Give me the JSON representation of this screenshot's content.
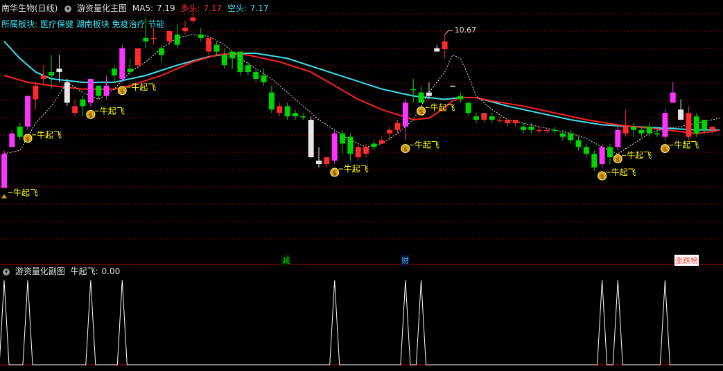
{
  "header": {
    "stock": "南华生物(日线)",
    "indicator": "游资量化主图",
    "ma5_label": "MA5:",
    "ma5_value": "7.19",
    "bull_label": "多头:",
    "bull_value": "7.17",
    "bear_label": "空头:",
    "bear_value": "7.17",
    "sector": "所属板块: 医疗保健 湖南板块 免疫治疗 节能"
  },
  "subheader": {
    "indicator": "游资量化副图",
    "signal_label": "牛起飞:",
    "signal_value": "0.00"
  },
  "signal_text": "牛起飞",
  "high_marker": "10.67",
  "tags": {
    "jian": "减",
    "cai": "财",
    "zhangdie": "涨跌榜"
  },
  "colors": {
    "up": "#ff2a2a",
    "down": "#00d400",
    "magenta": "#ff33ff",
    "white": "#e6e6e6",
    "ma_red": "#ff2020",
    "ma_cyan": "#40e0f0",
    "yellow": "#ffff00",
    "grid": "#8b0000",
    "axis": "#b00000"
  },
  "chart_data": {
    "type": "candlestick",
    "yrange": [
      4.6,
      11.2
    ],
    "candles": [
      [
        7.6,
        6.6,
        7.7,
        6.6,
        "m"
      ],
      [
        7.8,
        8.2,
        8.3,
        7.8,
        "m"
      ],
      [
        8.1,
        8.4,
        8.5,
        8.0,
        "g"
      ],
      [
        8.4,
        9.3,
        9.3,
        8.3,
        "m"
      ],
      [
        9.6,
        9.2,
        9.7,
        8.9,
        "r"
      ],
      [
        9.8,
        9.9,
        10.2,
        9.6,
        "r"
      ],
      [
        10.0,
        9.9,
        10.5,
        9.5,
        "g"
      ],
      [
        10.1,
        10.0,
        10.5,
        9.7,
        "w"
      ],
      [
        9.7,
        9.1,
        9.8,
        9.0,
        "w"
      ],
      [
        9.0,
        8.8,
        9.2,
        8.7,
        "r"
      ],
      [
        9.0,
        9.2,
        9.3,
        8.7,
        "g"
      ],
      [
        9.1,
        9.8,
        9.8,
        9.0,
        "m"
      ],
      [
        9.6,
        9.3,
        9.6,
        9.2,
        "g"
      ],
      [
        9.3,
        9.6,
        9.9,
        9.2,
        "m"
      ],
      [
        9.9,
        10.1,
        10.2,
        9.7,
        "g"
      ],
      [
        9.8,
        10.7,
        10.8,
        9.7,
        "m"
      ],
      [
        10.0,
        10.1,
        10.4,
        9.9,
        "g"
      ],
      [
        10.2,
        10.7,
        10.7,
        10.1,
        "r"
      ],
      [
        11.0,
        10.9,
        11.6,
        10.7,
        "g"
      ],
      [
        11.0,
        11.0,
        11.3,
        10.8,
        "r"
      ],
      [
        10.7,
        10.5,
        10.8,
        10.3,
        "g"
      ],
      [
        10.9,
        11.2,
        11.2,
        10.8,
        "r"
      ],
      [
        10.8,
        11.1,
        11.4,
        10.7,
        "g"
      ],
      [
        11.2,
        11.3,
        11.5,
        11.1,
        "r"
      ],
      [
        11.6,
        11.5,
        11.8,
        11.4,
        "r"
      ],
      [
        11.1,
        11.0,
        11.3,
        10.9,
        "g"
      ],
      [
        11.0,
        10.6,
        11.0,
        10.5,
        "r"
      ],
      [
        10.8,
        10.6,
        10.9,
        10.5,
        "g"
      ],
      [
        10.5,
        10.2,
        10.7,
        10.1,
        "g"
      ],
      [
        10.4,
        10.6,
        10.6,
        10.1,
        "g"
      ],
      [
        10.6,
        10.0,
        10.6,
        9.9,
        "g"
      ],
      [
        10.2,
        10.0,
        10.3,
        9.9,
        "g"
      ],
      [
        10.0,
        9.8,
        10.1,
        9.7,
        "g"
      ],
      [
        9.9,
        9.7,
        10.1,
        9.6,
        "g"
      ],
      [
        9.4,
        8.9,
        9.6,
        8.8,
        "g"
      ],
      [
        8.8,
        9.0,
        9.1,
        8.7,
        "r"
      ],
      [
        9.0,
        8.7,
        9.1,
        8.6,
        "g"
      ],
      [
        8.8,
        8.7,
        8.9,
        8.6,
        "g"
      ],
      [
        8.7,
        8.7,
        8.8,
        8.6,
        "g"
      ],
      [
        8.6,
        7.5,
        8.7,
        7.5,
        "w"
      ],
      [
        7.4,
        7.3,
        7.8,
        7.2,
        "w"
      ],
      [
        7.3,
        7.5,
        7.5,
        7.2,
        "r"
      ],
      [
        7.4,
        8.2,
        8.3,
        7.3,
        "m"
      ],
      [
        8.2,
        7.9,
        8.3,
        7.6,
        "g"
      ],
      [
        8.1,
        7.6,
        8.2,
        7.4,
        "g"
      ],
      [
        7.5,
        7.8,
        7.9,
        7.4,
        "r"
      ],
      [
        7.6,
        7.8,
        7.9,
        7.5,
        "r"
      ],
      [
        7.8,
        7.9,
        8.0,
        7.7,
        "g"
      ],
      [
        7.9,
        8.0,
        8.1,
        7.9,
        "r"
      ],
      [
        8.3,
        8.2,
        8.4,
        8.0,
        "r"
      ],
      [
        8.5,
        8.3,
        8.6,
        8.2,
        "r"
      ],
      [
        8.4,
        9.1,
        9.2,
        8.0,
        "m"
      ],
      [
        9.5,
        9.5,
        9.8,
        9.1,
        "g"
      ],
      [
        9.4,
        9.1,
        9.6,
        9.1,
        "g"
      ],
      [
        9.4,
        9.3,
        9.7,
        9.2,
        "w"
      ],
      [
        10.6,
        10.7,
        10.8,
        10.6,
        "w"
      ],
      [
        10.67,
        10.9,
        11.1,
        10.4,
        "r"
      ],
      [
        9.6,
        9.6,
        9.6,
        9.6,
        "w"
      ],
      [
        9.3,
        9.2,
        9.4,
        9.1,
        "g"
      ],
      [
        9.1,
        8.8,
        9.1,
        8.7,
        "g"
      ],
      [
        8.7,
        8.6,
        8.8,
        8.5,
        "g"
      ],
      [
        8.6,
        8.8,
        8.8,
        8.5,
        "r"
      ],
      [
        8.7,
        8.6,
        8.8,
        8.5,
        "g"
      ],
      [
        8.6,
        8.6,
        8.7,
        8.5,
        "r"
      ],
      [
        8.6,
        8.5,
        8.6,
        8.4,
        "r"
      ],
      [
        8.6,
        8.5,
        8.6,
        8.4,
        "r"
      ],
      [
        8.4,
        8.3,
        8.5,
        8.2,
        "g"
      ],
      [
        8.4,
        8.3,
        8.5,
        8.2,
        "g"
      ],
      [
        8.3,
        8.3,
        8.4,
        8.2,
        "r"
      ],
      [
        8.3,
        8.3,
        8.3,
        8.2,
        "r"
      ],
      [
        8.3,
        8.3,
        8.4,
        8.2,
        "g"
      ],
      [
        8.2,
        8.1,
        8.3,
        8.0,
        "g"
      ],
      [
        8.2,
        8.0,
        8.3,
        7.9,
        "g"
      ],
      [
        8.0,
        7.8,
        8.1,
        7.7,
        "g"
      ],
      [
        7.8,
        7.6,
        7.9,
        7.5,
        "g"
      ],
      [
        7.6,
        7.2,
        7.7,
        7.1,
        "g"
      ],
      [
        7.3,
        7.8,
        7.9,
        7.2,
        "m"
      ],
      [
        7.5,
        7.8,
        7.9,
        7.3,
        "g"
      ],
      [
        7.8,
        8.3,
        8.4,
        7.7,
        "m"
      ],
      [
        8.2,
        8.4,
        8.9,
        8.1,
        "r"
      ],
      [
        8.4,
        8.3,
        8.5,
        8.1,
        "g"
      ],
      [
        8.3,
        8.2,
        8.4,
        8.1,
        "g"
      ],
      [
        8.4,
        8.2,
        8.5,
        8.1,
        "g"
      ],
      [
        8.2,
        8.2,
        8.3,
        8.1,
        "g"
      ],
      [
        8.1,
        8.8,
        8.9,
        8.0,
        "m"
      ],
      [
        9.4,
        9.1,
        9.7,
        9.1,
        "m"
      ],
      [
        8.9,
        8.6,
        9.2,
        8.6,
        "w"
      ],
      [
        8.8,
        8.1,
        9.0,
        8.0,
        "r"
      ],
      [
        8.2,
        8.7,
        8.8,
        8.1,
        "g"
      ],
      [
        8.6,
        8.3,
        8.6,
        8.2,
        "g"
      ],
      [
        8.4,
        8.3,
        8.4,
        8.2,
        "r"
      ]
    ],
    "ma_red": [
      [
        0,
        9.9
      ],
      [
        3,
        9.7
      ],
      [
        6,
        9.6
      ],
      [
        10,
        9.5
      ],
      [
        14,
        9.5
      ],
      [
        16,
        9.6
      ],
      [
        20,
        9.9
      ],
      [
        24,
        10.3
      ],
      [
        27,
        10.5
      ],
      [
        29,
        10.55
      ],
      [
        31,
        10.5
      ],
      [
        35,
        10.3
      ],
      [
        39,
        10.0
      ],
      [
        42,
        9.6
      ],
      [
        45,
        9.2
      ],
      [
        48,
        8.9
      ],
      [
        50,
        8.75
      ],
      [
        52,
        8.6
      ],
      [
        54,
        8.65
      ],
      [
        56,
        8.95
      ],
      [
        57,
        9.15
      ],
      [
        58,
        9.25
      ],
      [
        60,
        9.25
      ],
      [
        62,
        9.15
      ],
      [
        66,
        9.0
      ],
      [
        70,
        8.8
      ],
      [
        74,
        8.6
      ],
      [
        78,
        8.45
      ],
      [
        80,
        8.4
      ],
      [
        82,
        8.35
      ],
      [
        84,
        8.3
      ],
      [
        86,
        8.25
      ],
      [
        88,
        8.2
      ],
      [
        90,
        8.25
      ],
      [
        91,
        8.3
      ]
    ],
    "ma_cyan": [
      [
        0,
        10.9
      ],
      [
        2,
        10.4
      ],
      [
        4,
        10.0
      ],
      [
        6,
        9.8
      ],
      [
        10,
        9.7
      ],
      [
        14,
        9.7
      ],
      [
        18,
        9.9
      ],
      [
        22,
        10.2
      ],
      [
        26,
        10.45
      ],
      [
        29,
        10.55
      ],
      [
        32,
        10.55
      ],
      [
        36,
        10.4
      ],
      [
        40,
        10.1
      ],
      [
        44,
        9.8
      ],
      [
        48,
        9.5
      ],
      [
        52,
        9.3
      ],
      [
        56,
        9.2
      ],
      [
        58,
        9.25
      ],
      [
        60,
        9.25
      ],
      [
        64,
        9.0
      ],
      [
        68,
        8.8
      ],
      [
        72,
        8.6
      ],
      [
        76,
        8.45
      ],
      [
        80,
        8.4
      ],
      [
        84,
        8.35
      ],
      [
        88,
        8.3
      ],
      [
        91,
        8.3
      ]
    ],
    "ma_dashed": [
      [
        0,
        7.6
      ],
      [
        2,
        7.7
      ],
      [
        4,
        8.5
      ],
      [
        6,
        9.0
      ],
      [
        8,
        9.7
      ],
      [
        10,
        9.4
      ],
      [
        12,
        9.2
      ],
      [
        14,
        9.5
      ],
      [
        16,
        10.0
      ],
      [
        18,
        10.3
      ],
      [
        20,
        10.7
      ],
      [
        22,
        11.0
      ],
      [
        24,
        11.1
      ],
      [
        26,
        11.05
      ],
      [
        28,
        10.8
      ],
      [
        30,
        10.4
      ],
      [
        32,
        10.1
      ],
      [
        34,
        9.8
      ],
      [
        36,
        9.4
      ],
      [
        38,
        9.0
      ],
      [
        40,
        8.6
      ],
      [
        42,
        8.3
      ],
      [
        44,
        8.0
      ],
      [
        46,
        7.8
      ],
      [
        48,
        7.9
      ],
      [
        50,
        8.2
      ],
      [
        52,
        8.6
      ],
      [
        54,
        9.4
      ],
      [
        56,
        10.0
      ],
      [
        57,
        10.5
      ],
      [
        58,
        10.4
      ],
      [
        59,
        9.9
      ],
      [
        60,
        9.3
      ],
      [
        62,
        8.9
      ],
      [
        64,
        8.6
      ],
      [
        66,
        8.5
      ],
      [
        68,
        8.4
      ],
      [
        70,
        8.3
      ],
      [
        72,
        8.2
      ],
      [
        74,
        8.05
      ],
      [
        76,
        7.8
      ],
      [
        78,
        7.6
      ],
      [
        80,
        7.9
      ],
      [
        82,
        8.2
      ],
      [
        84,
        8.35
      ],
      [
        86,
        8.4
      ],
      [
        88,
        8.5
      ],
      [
        90,
        8.6
      ],
      [
        91,
        8.65
      ]
    ],
    "signals": [
      {
        "i": 0,
        "label": "牛起飞",
        "bag": false
      },
      {
        "i": 3,
        "label": "牛起飞",
        "bag": true
      },
      {
        "i": 11,
        "label": "牛起飞",
        "bag": true
      },
      {
        "i": 15,
        "label": "牛起飞",
        "bag": true
      },
      {
        "i": 42,
        "label": "牛起飞",
        "bag": true
      },
      {
        "i": 51,
        "label": "牛起飞",
        "bag": true
      },
      {
        "i": 53,
        "label": "牛起飞",
        "bag": true
      },
      {
        "i": 76,
        "label": "牛起飞",
        "bag": true
      },
      {
        "i": 78,
        "label": "牛起飞",
        "bag": true
      },
      {
        "i": 84,
        "label": "牛起飞",
        "bag": true
      }
    ],
    "sub_spikes": [
      0,
      3,
      11,
      15,
      42,
      51,
      53,
      76,
      78,
      84
    ]
  }
}
